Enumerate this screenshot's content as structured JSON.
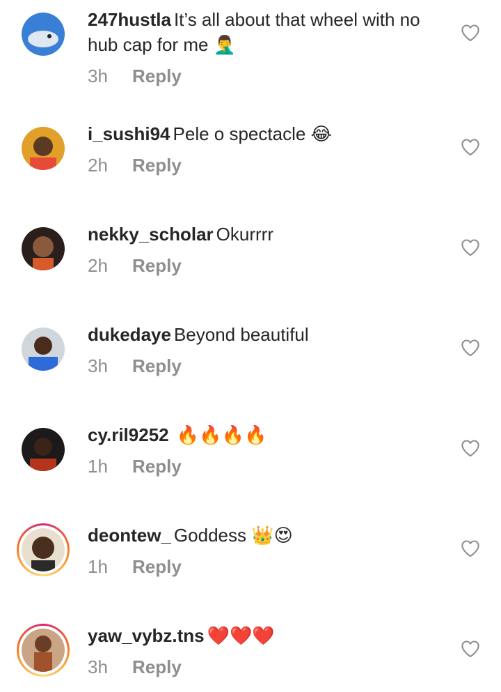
{
  "comments": [
    {
      "username": "247hustla",
      "text": "It’s all about that wheel with no hub cap for me",
      "emoji": "🤦‍♂️",
      "time": "3h",
      "reply": "Reply"
    },
    {
      "username": "i_sushi94",
      "text": "Pele o spectacle",
      "emoji": "😂",
      "time": "2h",
      "reply": "Reply"
    },
    {
      "username": "nekky_scholar",
      "text": "Okurrrr",
      "emoji": "",
      "time": "2h",
      "reply": "Reply"
    },
    {
      "username": "dukedaye",
      "text": "Beyond beautiful",
      "emoji": "",
      "time": "3h",
      "reply": "Reply"
    },
    {
      "username": "cy.ril9252",
      "text": "",
      "emoji": "🔥🔥🔥🔥",
      "time": "1h",
      "reply": "Reply"
    },
    {
      "username": "deontew_",
      "text": "Goddess",
      "emoji": "👑😍",
      "time": "1h",
      "reply": "Reply"
    },
    {
      "username": "yaw_vybz.tns",
      "text": "",
      "emoji": "❤️❤️❤️",
      "time": "3h",
      "reply": "Reply"
    }
  ],
  "colors": {
    "text": "#262626",
    "secondary": "#8e8e8e",
    "heart": "#8e8e8e"
  },
  "icons": {
    "like": "heart-outline-icon"
  }
}
